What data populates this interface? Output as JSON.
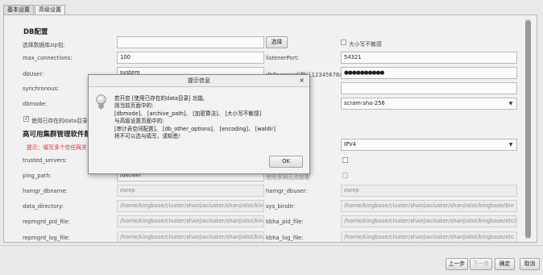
{
  "tabs": [
    "基本设置",
    "高级设置"
  ],
  "db": {
    "section_title": "DB配置",
    "zip_label": "选择数据库zip包:",
    "zip_value": "",
    "select_button": "选择",
    "case_insensitive_label": "大小写不敏感",
    "max_connections_label": "max_connections:",
    "max_connections_value": "100",
    "listener_port_label": "listenerPort:",
    "listener_port_value": "54321",
    "dbuser_label": "dbUser:",
    "dbuser_value": "system",
    "dbpassword_label": "dbPassword(默认12345678ab):",
    "dbpassword_value": "●●●●●●●●●●",
    "synchronous_label": "synchronous:",
    "dbmode_label": "dbmode:",
    "auth_value": "scram-sha-256",
    "use_data_dir_label": "使用已存在的data目录"
  },
  "ha": {
    "section_title": "高可用集群管理软件配",
    "warning": "提示：填写多个信任网关",
    "ip_type_value": "IPV4",
    "trusted_servers_label": "trusted_servers:",
    "ping_path_label": "ping_path:",
    "ping_path_value": "/usr/bin",
    "multi_nic_label": "使用多网元点部署",
    "hamgr_dbname_label": "hamgr_dbname:",
    "hamgr_dbname_value": "esrep",
    "hamgr_dbuser_label": "hamgr_dbuser:",
    "hamgr_dbuser_value": "esrep",
    "data_directory_label": "data_directory:",
    "data_directory_value": "/home/kingbase/cluster/shanjiacluster/shanjiatst/kingbase/da",
    "sys_bindir_label": "sys_bindir:",
    "sys_bindir_value": "/home/kingbase/cluster/shanjiacluster/shanjiatst/kingbase/bin",
    "repmgrd_pid_label": "repmgrd_pid_file:",
    "repmgrd_pid_value": "/home/kingbase/cluster/shanjiacluster/shanjiatst/kingbase/etc",
    "kbha_pid_label": "kbha_pid_file:",
    "kbha_pid_value": "/home/kingbase/cluster/shanjiacluster/shanjiatst/kingbase/etc/kbha.pid",
    "repmgrd_log_label": "repmgrd_log_file:",
    "repmgrd_log_value": "/home/kingbase/cluster/shanjiacluster/shanjiatst/kingbase/etc",
    "kbha_log_label": "kbha_log_file:",
    "kbha_log_value": "/home/kingbase/cluster/shanjiacluster/shanjiatst/kingbase/etc"
  },
  "dialog": {
    "title": "提示信息",
    "close": "×",
    "lines": [
      "若开启 [使用已存在的data目录] 功能,",
      "则当前页面中的:",
      "[dbmode]、 [archive_path]、 [加密算法]、 [大小写不敏感]",
      "与高级设置页面中的:",
      "[审计表空间配置]、 [db_other_options]、 [encoding]、 [waldir]",
      "将不可以选与填写，请知悉！"
    ],
    "ok": "OK"
  },
  "footer": {
    "prev": "上一步",
    "next": "下一步",
    "confirm": "确定",
    "cancel": "取消"
  }
}
